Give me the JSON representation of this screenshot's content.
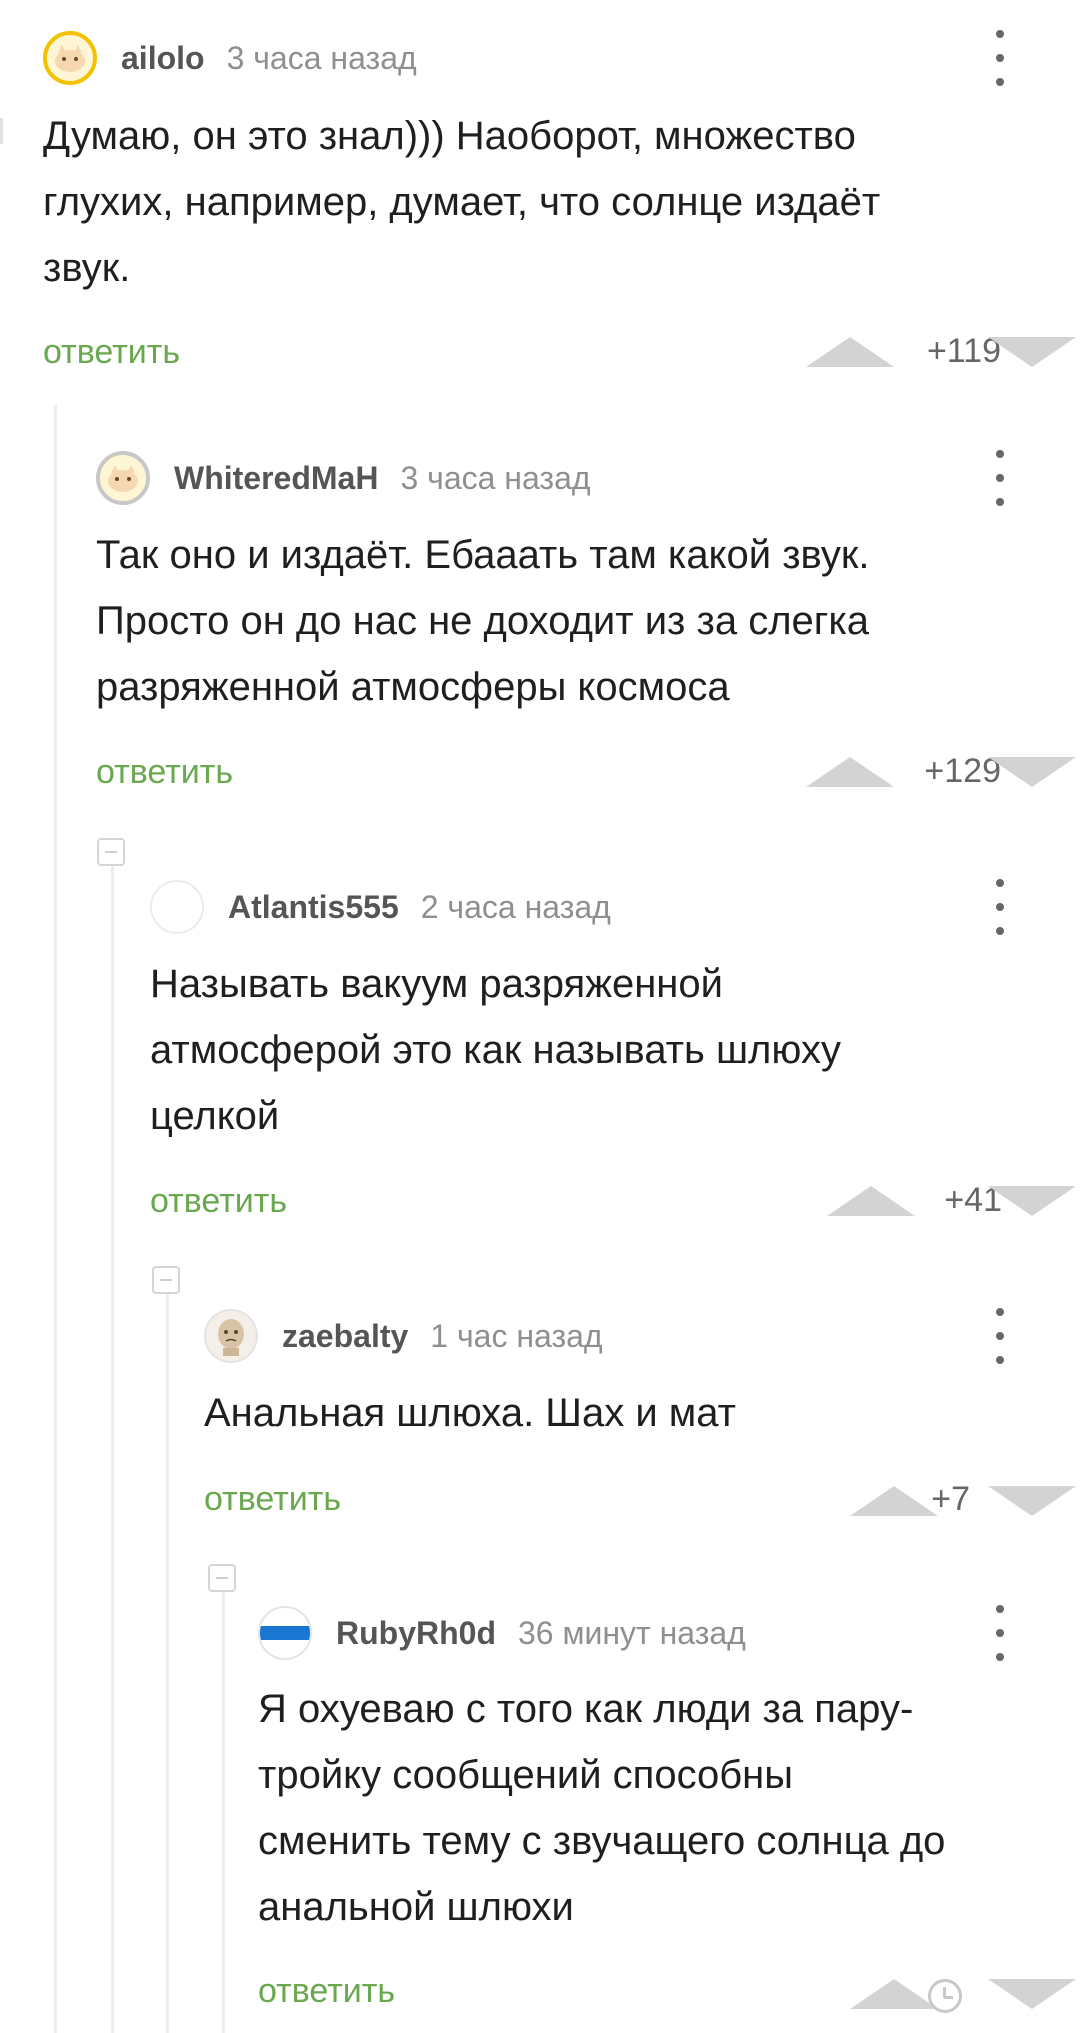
{
  "comments": [
    {
      "username": "ailolo",
      "time": "3 часа назад",
      "text": "Думаю, он это знал))) Наоборот, множество\nглухих, например, думает, что солнце издаёт\nзвук.",
      "reply_label": "ответить",
      "rating": "+119",
      "avatar_icon": "kitten-avatar-icon"
    },
    {
      "username": "WhiteredMaH",
      "time": "3 часа назад",
      "text": "Так оно и издаёт. Ебааать там какой звук.\nПросто он до нас не доходит из за слегка\nразряженной атмосферы космоса",
      "reply_label": "ответить",
      "rating": "+129",
      "avatar_icon": "kitten-avatar-icon"
    },
    {
      "username": "Atlantis555",
      "time": "2 часа назад",
      "text": "Называть вакуум разряженной\nатмосферой это как называть шлюху\nцелкой",
      "reply_label": "ответить",
      "rating": "+41",
      "avatar_icon": "empty-avatar-icon"
    },
    {
      "username": "zaebalty",
      "time": "1 час назад",
      "text": "Анальная шлюха. Шах и мат",
      "reply_label": "ответить",
      "rating": "+7",
      "avatar_icon": "face-avatar-icon"
    },
    {
      "username": "RubyRh0d",
      "time": "36 минут назад",
      "text": "Я охуеваю с того как люди за пару-\nтройку сообщений способны\nсменить тему с звучащего солнца до\nанальной шлюхи",
      "reply_label": "ответить",
      "rating_icon": "clock-icon",
      "avatar_icon": "blue-stripe-avatar-icon"
    }
  ],
  "colors": {
    "reply_green": "#6aa84f",
    "vote_gray": "#d3d3d3",
    "thread_line": "#ededed",
    "username": "#555555",
    "time": "#8f8f8f",
    "avatar_yellow": "#f2c200",
    "avatar_blue": "#1976d2"
  }
}
